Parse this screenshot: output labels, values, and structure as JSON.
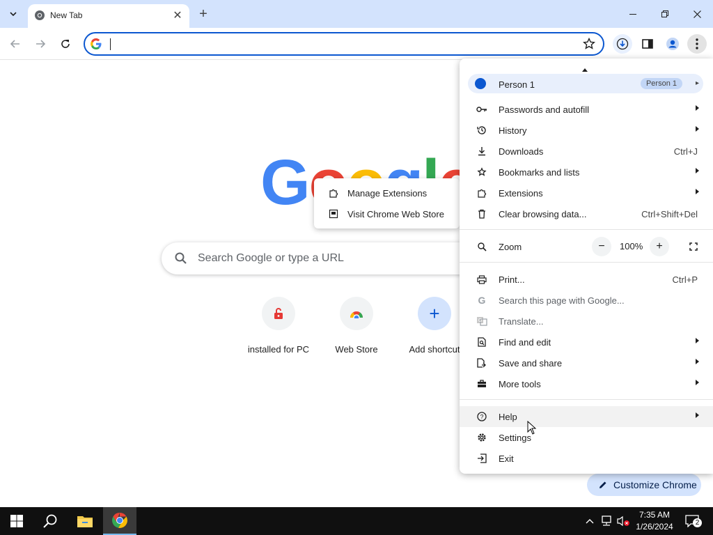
{
  "browser": {
    "tab_title": "New Tab",
    "omnibox": {
      "value": "",
      "placeholder": ""
    }
  },
  "ntp": {
    "logo_text": "Google",
    "search_placeholder": "Search Google or type a URL",
    "shortcuts": [
      {
        "label": "installed for PC",
        "icon": "lock-icon"
      },
      {
        "label": "Web Store",
        "icon": "web-store-icon"
      },
      {
        "label": "Add shortcut",
        "icon": "plus-icon"
      }
    ],
    "customize_label": "Customize Chrome"
  },
  "extensions_submenu": {
    "items": [
      {
        "label": "Manage Extensions",
        "icon": "puzzle-icon"
      },
      {
        "label": "Visit Chrome Web Store",
        "icon": "store-icon"
      }
    ]
  },
  "menu": {
    "profile": {
      "name": "Person 1",
      "chip": "Person 1"
    },
    "items": [
      {
        "label": "Passwords and autofill",
        "shortcut": "",
        "submenu": true,
        "icon": "key-icon"
      },
      {
        "label": "History",
        "shortcut": "",
        "submenu": true,
        "icon": "history-icon"
      },
      {
        "label": "Downloads",
        "shortcut": "Ctrl+J",
        "submenu": false,
        "icon": "download-icon"
      },
      {
        "label": "Bookmarks and lists",
        "shortcut": "",
        "submenu": true,
        "icon": "star-icon"
      },
      {
        "label": "Extensions",
        "shortcut": "",
        "submenu": true,
        "icon": "puzzle-icon"
      },
      {
        "label": "Clear browsing data...",
        "shortcut": "Ctrl+Shift+Del",
        "submenu": false,
        "icon": "trash-icon"
      }
    ],
    "zoom": {
      "label": "Zoom",
      "value": "100%",
      "minus": "−",
      "plus": "+"
    },
    "items2": [
      {
        "label": "Print...",
        "shortcut": "Ctrl+P",
        "submenu": false,
        "icon": "printer-icon"
      },
      {
        "label": "Search this page with Google...",
        "shortcut": "",
        "submenu": false,
        "icon": "google-g-icon"
      },
      {
        "label": "Translate...",
        "shortcut": "",
        "submenu": false,
        "icon": "translate-icon"
      },
      {
        "label": "Find and edit",
        "shortcut": "",
        "submenu": true,
        "icon": "find-icon"
      },
      {
        "label": "Save and share",
        "shortcut": "",
        "submenu": true,
        "icon": "save-share-icon"
      },
      {
        "label": "More tools",
        "shortcut": "",
        "submenu": true,
        "icon": "toolbox-icon"
      }
    ],
    "items3": [
      {
        "label": "Help",
        "shortcut": "",
        "submenu": true,
        "icon": "help-icon"
      },
      {
        "label": "Settings",
        "shortcut": "",
        "submenu": false,
        "icon": "gear-icon"
      },
      {
        "label": "Exit",
        "shortcut": "",
        "submenu": false,
        "icon": "exit-icon"
      }
    ]
  },
  "taskbar": {
    "time": "7:35 AM",
    "date": "1/26/2024",
    "notification_count": "2"
  },
  "colors": {
    "accent": "#0b57d0",
    "tabstrip": "#d3e3fd",
    "google_blue": "#4285f4",
    "google_red": "#ea4335",
    "google_yellow": "#fbbc05",
    "google_green": "#34a853"
  }
}
